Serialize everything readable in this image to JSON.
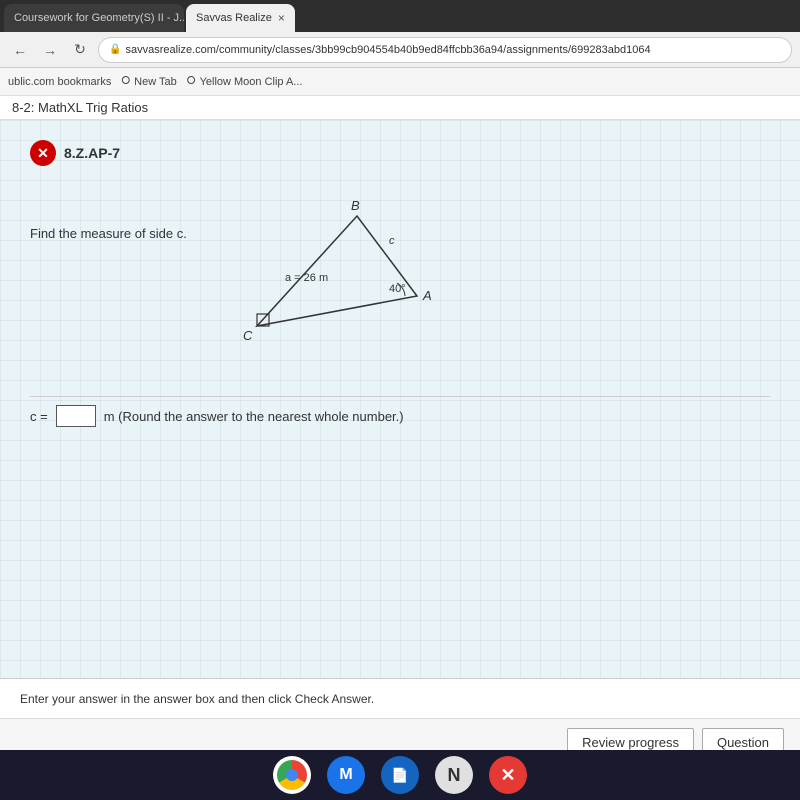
{
  "browser": {
    "tabs": [
      {
        "id": "tab1",
        "label": "Coursework for Geometry(S) II - J...",
        "active": false,
        "close": "×"
      },
      {
        "id": "tab2",
        "label": "Savvas Realize",
        "active": true,
        "close": "×"
      }
    ],
    "address": "savvasrealize.com/community/classes/3bb99cb904554b40b9ed84ffcbb36a94/assignments/699283abd1064",
    "bookmarks": [
      {
        "label": "ublic.com bookmarks"
      },
      {
        "label": "New Tab"
      },
      {
        "label": "Yellow Moon Clip A..."
      }
    ]
  },
  "page": {
    "title": "8-2: MathXL Trig Ratios",
    "question_id": "8.Z.AP-7",
    "problem_text": "Find the measure of side c.",
    "triangle": {
      "vertex_a": "A",
      "vertex_b": "B",
      "vertex_c": "C",
      "side_a_label": "a = 26 m",
      "side_c_label": "c",
      "angle_label": "40°"
    },
    "answer_prefix": "c =",
    "answer_suffix": "m  (Round the answer to the nearest whole number.)",
    "footer_instruction": "Enter your answer in the answer box and then click Check Answer.",
    "review_progress_btn": "Review progress",
    "question_btn": "Question"
  },
  "taskbar": {
    "icons": [
      "chrome",
      "meet",
      "docs",
      "avast"
    ]
  }
}
